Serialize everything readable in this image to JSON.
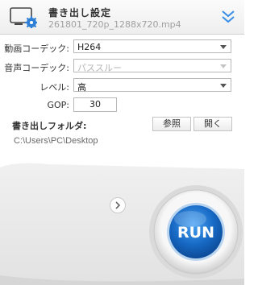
{
  "header": {
    "title": "書き出し設定",
    "filename": "261801_720p_1288x720.mp4",
    "icon": "monitor-gear-icon",
    "expand_icon": "double-chevron-down-icon"
  },
  "settings": {
    "video_codec": {
      "label": "動画コーデック:",
      "value": "H264"
    },
    "audio_codec": {
      "label": "音声コーデック:",
      "value": "パススルー"
    },
    "level": {
      "label": "レベル:",
      "value": "高"
    },
    "gop": {
      "label": "GOP:",
      "value": "30"
    }
  },
  "output": {
    "label": "書き出しフォルダ:",
    "browse_label": "参照",
    "open_label": "開く",
    "path": "C:\\Users\\PC\\Desktop"
  },
  "run": {
    "label": "RUN"
  },
  "colors": {
    "accent": "#2f7fd6",
    "run_blue": "#1769c4"
  }
}
